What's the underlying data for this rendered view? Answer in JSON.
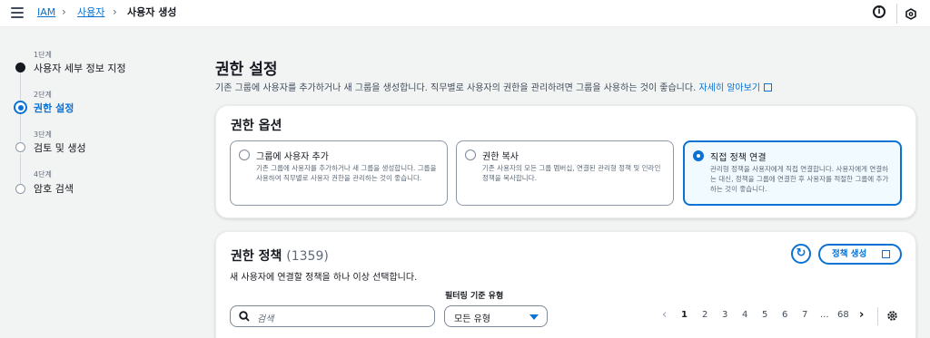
{
  "breadcrumb": {
    "root": "IAM",
    "users": "사용자",
    "current": "사용자 생성"
  },
  "steps": [
    {
      "num": "1단계",
      "label": "사용자 세부 정보 지정",
      "state": "done"
    },
    {
      "num": "2단계",
      "label": "권한 설정",
      "state": "current"
    },
    {
      "num": "3단계",
      "label": "검토 및 생성",
      "state": "future"
    },
    {
      "num": "4단계",
      "label": "암호 검색",
      "state": "future"
    }
  ],
  "main": {
    "title": "권한 설정",
    "description": "기존 그룹에 사용자를 추가하거나 새 그룹을 생성합니다. 직무별로 사용자의 권한을 관리하려면 그룹을 사용하는 것이 좋습니다.",
    "learn_more": "자세히 알아보기"
  },
  "options": {
    "title": "권한 옵션",
    "tiles": [
      {
        "title": "그룹에 사용자 추가",
        "desc": "기존 그룹에 사용자를 추가하거나 새 그룹을 생성합니다. 그룹을 사용하여 직무별로 사용자 권한을 관리하는 것이 좋습니다.",
        "selected": false
      },
      {
        "title": "권한 복사",
        "desc": "기존 사용자의 모든 그룹 멤버십, 연결된 관리형 정책 및 인라인 정책을 복사합니다.",
        "selected": false
      },
      {
        "title": "직접 정책 연결",
        "desc": "관리형 정책을 사용자에게 직접 연결합니다. 사용자에게 연결하는 대신, 정책을 그룹에 연결한 후 사용자를 적절한 그룹에 추가하는 것이 좋습니다.",
        "selected": true
      }
    ]
  },
  "policies": {
    "title": "권한 정책",
    "count": "(1359)",
    "description": "새 사용자에 연결할 정책을 하나 이상 선택합니다.",
    "create_label": "정책 생성",
    "filter_label": "필터링 기준 유형",
    "search_placeholder": "검색",
    "filter_value": "모든 유형",
    "pages": [
      "1",
      "2",
      "3",
      "4",
      "5",
      "6",
      "7",
      "...",
      "68"
    ],
    "current_page": "1"
  },
  "colors": {
    "accent": "#0972d3",
    "text": "#16191f",
    "background": "#f2f3f3"
  }
}
